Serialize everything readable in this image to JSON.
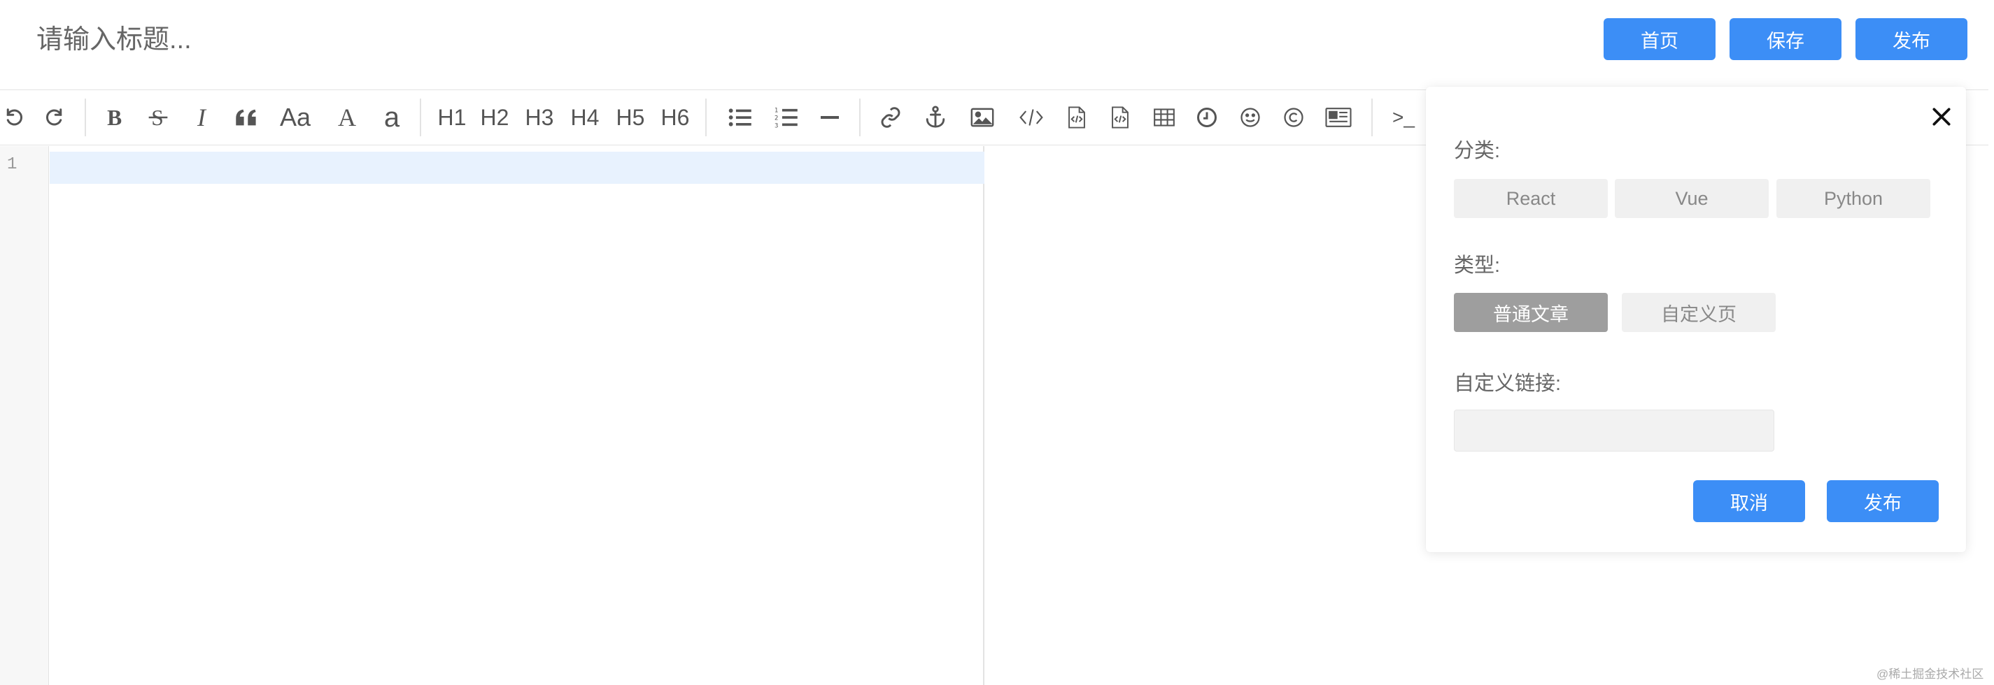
{
  "header": {
    "title_placeholder": "请输入标题...",
    "home_label": "首页",
    "save_label": "保存",
    "publish_label": "发布"
  },
  "toolbar": {
    "italic": "I",
    "font_size": "Aa",
    "uppercase": "A",
    "lowercase": "a",
    "h1": "H1",
    "h2": "H2",
    "h3": "H3",
    "h4": "H4",
    "h5": "H5",
    "h6": "H6",
    "terminal": ">_",
    "icons": [
      "undo-icon",
      "redo-icon",
      "bold-icon",
      "strikethrough-icon",
      "italic-icon",
      "quote-icon",
      "font-size-icon",
      "uppercase-icon",
      "lowercase-icon",
      "heading-icons",
      "unordered-list-icon",
      "ordered-list-icon",
      "horizontal-rule-icon",
      "link-icon",
      "anchor-icon",
      "image-icon",
      "code-icon",
      "code-block-icon",
      "code-file-icon",
      "table-icon",
      "clock-icon",
      "emoji-icon",
      "copyright-icon",
      "page-break-icon",
      "terminal-icon"
    ]
  },
  "editor": {
    "line_numbers": [
      "1"
    ]
  },
  "panel": {
    "category_label": "分类:",
    "categories": [
      "React",
      "Vue",
      "Python"
    ],
    "type_label": "类型:",
    "types": [
      "普通文章",
      "自定义页"
    ],
    "selected_type": "普通文章",
    "custom_link_label": "自定义链接:",
    "custom_link_value": "",
    "cancel_label": "取消",
    "publish_label": "发布"
  },
  "colors": {
    "primary": "#3c8ef6",
    "active_chip": "#9e9e9e",
    "chip_bg": "#f0f0f0",
    "active_line": "#e8f2fe"
  },
  "watermark": "@稀土掘金技术社区"
}
